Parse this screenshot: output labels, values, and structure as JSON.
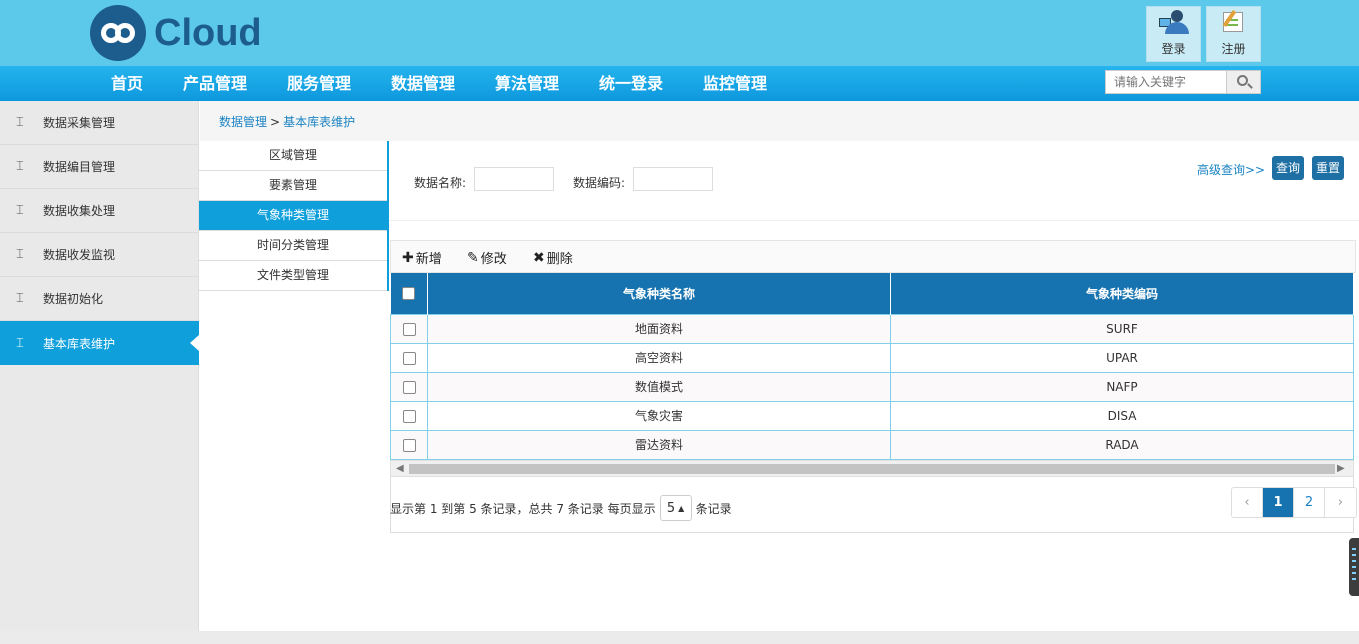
{
  "app": {
    "logo_text": "Cloud",
    "login_label": "登录",
    "register_label": "注册"
  },
  "nav": {
    "items": [
      "首页",
      "产品管理",
      "服务管理",
      "数据管理",
      "算法管理",
      "统一登录",
      "监控管理"
    ],
    "search_placeholder": "请输入关键字"
  },
  "sidebar": {
    "items": [
      {
        "label": "数据采集管理",
        "icon": "module-icon"
      },
      {
        "label": "数据编目管理",
        "icon": "module-icon"
      },
      {
        "label": "数据收集处理",
        "icon": "module-icon"
      },
      {
        "label": "数据收发监视",
        "icon": "module-icon"
      },
      {
        "label": "数据初始化",
        "icon": "module-icon"
      },
      {
        "label": "基本库表维护",
        "icon": "module-icon",
        "active": true
      }
    ]
  },
  "breadcrumb": {
    "parent": "数据管理",
    "separator": ">",
    "current": "基本库表维护"
  },
  "submenu": {
    "items": [
      "区域管理",
      "要素管理",
      "气象种类管理",
      "时间分类管理",
      "文件类型管理"
    ],
    "active_index": 2
  },
  "query": {
    "name_label": "数据名称:",
    "name_value": "",
    "code_label": "数据编码:",
    "code_value": "",
    "advanced_link": "高级查询>>",
    "search_button": "查询",
    "reset_button": "重置"
  },
  "toolbar": {
    "add_label": "新增",
    "edit_label": "修改",
    "delete_label": "删除"
  },
  "table": {
    "columns": [
      "气象种类名称",
      "气象种类编码"
    ],
    "rows": [
      {
        "name": "地面资料",
        "code": "SURF"
      },
      {
        "name": "高空资料",
        "code": "UPAR"
      },
      {
        "name": "数值模式",
        "code": "NAFP"
      },
      {
        "name": "气象灾害",
        "code": "DISA"
      },
      {
        "name": "雷达资料",
        "code": "RADA"
      }
    ]
  },
  "pagination": {
    "info_prefix": "显示第 1 到第 5 条记录，总共 7 条记录 每页显示",
    "page_size": "5",
    "info_suffix": "条记录",
    "prev": "‹",
    "pages": [
      "1",
      "2"
    ],
    "current_page": "1",
    "next": "›"
  },
  "colors": {
    "header_bg": "#5cc8ea",
    "nav_bg": "#0d98dd",
    "accent": "#0fa0dc",
    "table_header": "#1673b0",
    "brand_dark": "#1d5d8e"
  }
}
